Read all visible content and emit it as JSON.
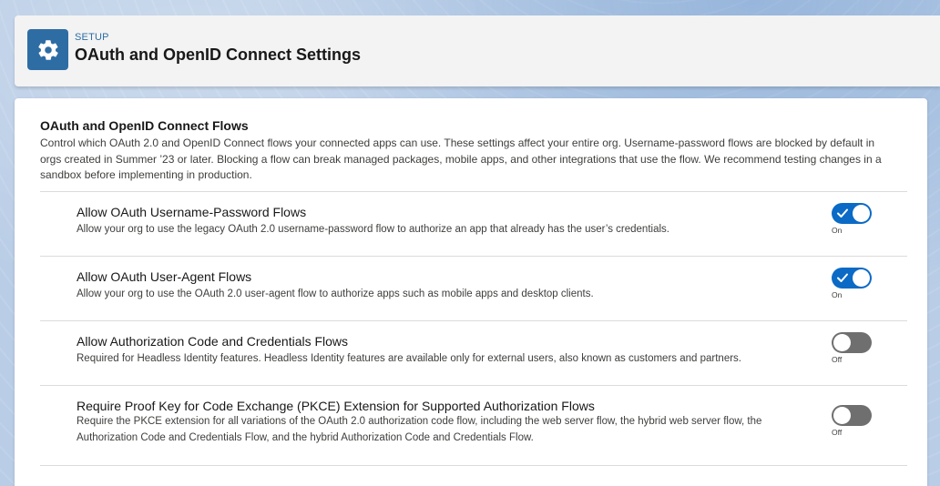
{
  "header": {
    "eyebrow": "SETUP",
    "title": "OAuth and OpenID Connect Settings",
    "icon": "gear-icon"
  },
  "section": {
    "title": "OAuth and OpenID Connect Flows",
    "description": "Control which OAuth 2.0 and OpenID Connect flows your connected apps can use. These settings affect your entire org. Username-password flows are blocked by default in orgs created in Summer ’23 or later. Blocking a flow can break managed packages, mobile apps, and other integrations that use the flow. We recommend testing changes in a sandbox before implementing in production."
  },
  "settings": [
    {
      "title": "Allow OAuth Username-Password Flows",
      "description": "Allow your org to use the legacy OAuth 2.0 username-password flow to authorize an app that already has the user’s credentials.",
      "enabled": true,
      "state_label": "On"
    },
    {
      "title": "Allow OAuth User-Agent Flows",
      "description": "Allow your org to use the OAuth 2.0 user-agent flow to authorize apps such as mobile apps and desktop clients.",
      "enabled": true,
      "state_label": "On"
    },
    {
      "title": "Allow Authorization Code and Credentials Flows",
      "description": "Required for Headless Identity features. Headless Identity features are available only for external users, also known as customers and partners.",
      "enabled": false,
      "state_label": "Off"
    },
    {
      "title": "Require Proof Key for Code Exchange (PKCE) Extension for Supported Authorization Flows",
      "description": "Require the PKCE extension for all variations of the OAuth 2.0 authorization code flow, including the web server flow, the hybrid web server flow, the Authorization Code and Credentials Flow, and the hybrid Authorization Code and Credentials Flow.",
      "enabled": false,
      "state_label": "Off"
    }
  ],
  "colors": {
    "accent": "#0b6ac5",
    "header_icon_bg": "#2e6da4",
    "toggle_off": "#6f6f6f"
  }
}
